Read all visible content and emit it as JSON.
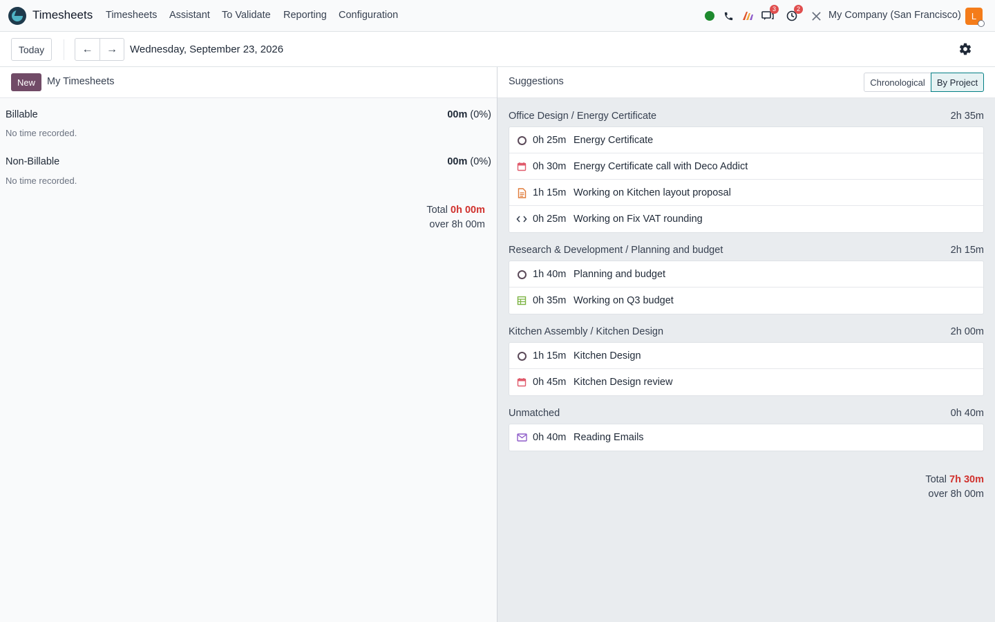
{
  "navbar": {
    "app_name": "Timesheets",
    "menu": [
      "Timesheets",
      "Assistant",
      "To Validate",
      "Reporting",
      "Configuration"
    ],
    "icons": [
      "status-online-icon",
      "phone-icon",
      "ai-icon",
      "messages-icon",
      "activity-clock-icon",
      "tools-icon"
    ],
    "messages_badge": "3",
    "activities_badge": "2",
    "company": "My Company (San Francisco)",
    "avatar_letter": "L"
  },
  "controls": {
    "today_label": "Today",
    "prev_icon": "←",
    "next_icon": "→",
    "date": "Wednesday, September 23, 2026",
    "settings_icon": "gear-icon"
  },
  "left": {
    "new_label": "New",
    "title": "My Timesheets",
    "billable": {
      "label": "Billable",
      "value": "00m",
      "pct": "(0%)",
      "empty": "No time recorded."
    },
    "non_billable": {
      "label": "Non-Billable",
      "value": "00m",
      "pct": "(0%)",
      "empty": "No time recorded."
    },
    "total_label": "Total",
    "total_value": "0h 00m",
    "over_label": "over 8h 00m"
  },
  "right": {
    "title": "Suggestions",
    "toggle_chrono": "Chronological",
    "toggle_project": "By Project",
    "groups": [
      {
        "title": "Office Design / Energy Certificate",
        "total": "2h 35m",
        "items": [
          {
            "icon": "task-circle-icon",
            "duration": "0h 25m",
            "label": "Energy Certificate"
          },
          {
            "icon": "calendar-icon",
            "duration": "0h 30m",
            "label": "Energy Certificate call with Deco Addict"
          },
          {
            "icon": "document-icon",
            "duration": "1h 15m",
            "label": "Working on Kitchen layout proposal"
          },
          {
            "icon": "code-icon",
            "duration": "0h 25m",
            "label": "Working on Fix VAT rounding"
          }
        ]
      },
      {
        "title": "Research & Development / Planning and budget",
        "total": "2h 15m",
        "items": [
          {
            "icon": "task-circle-icon",
            "duration": "1h 40m",
            "label": "Planning and budget"
          },
          {
            "icon": "spreadsheet-icon",
            "duration": "0h 35m",
            "label": "Working on Q3 budget"
          }
        ]
      },
      {
        "title": "Kitchen Assembly / Kitchen Design",
        "total": "2h 00m",
        "items": [
          {
            "icon": "task-circle-icon",
            "duration": "1h 15m",
            "label": "Kitchen Design"
          },
          {
            "icon": "calendar-icon",
            "duration": "0h 45m",
            "label": "Kitchen Design review"
          }
        ]
      },
      {
        "title": "Unmatched",
        "total": "0h 40m",
        "items": [
          {
            "icon": "envelope-icon",
            "duration": "0h 40m",
            "label": "Reading Emails"
          }
        ]
      }
    ],
    "total_label": "Total",
    "total_value": "7h 30m",
    "over_label": "over 8h 00m"
  },
  "colors": {
    "brand": "#714b67",
    "accent_teal": "#017e84",
    "over_red": "#d0312d",
    "calendar_red": "#e05a6b",
    "document_orange": "#e07b39",
    "spreadsheet_green": "#7cb342",
    "envelope_purple": "#8e5bc9"
  }
}
